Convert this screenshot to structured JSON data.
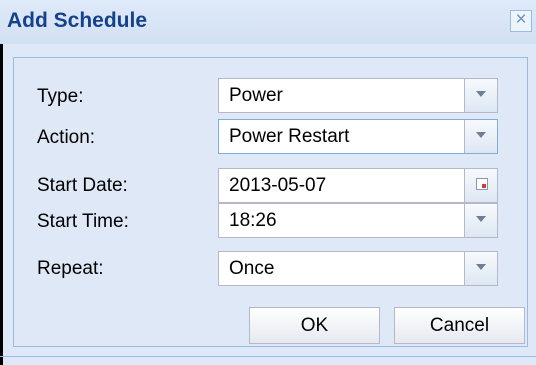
{
  "dialog": {
    "title": "Add Schedule",
    "close_glyph": "×"
  },
  "form": {
    "type": {
      "label": "Type:",
      "value": "Power",
      "icon": "chevron-down-icon"
    },
    "action": {
      "label": "Action:",
      "value": "Power Restart",
      "icon": "chevron-down-icon"
    },
    "start_date": {
      "label": "Start Date:",
      "value": "2013-05-07",
      "icon": "calendar-icon"
    },
    "start_time": {
      "label": "Start Time:",
      "value": "18:26",
      "icon": "chevron-down-icon"
    },
    "repeat": {
      "label": "Repeat:",
      "value": "Once",
      "icon": "chevron-down-icon"
    }
  },
  "buttons": {
    "ok": "OK",
    "cancel": "Cancel"
  },
  "colors": {
    "title": "#15428b",
    "panel_bg": "#dfe8f6",
    "border": "#99bbe8",
    "field_border": "#b5b8c8"
  }
}
